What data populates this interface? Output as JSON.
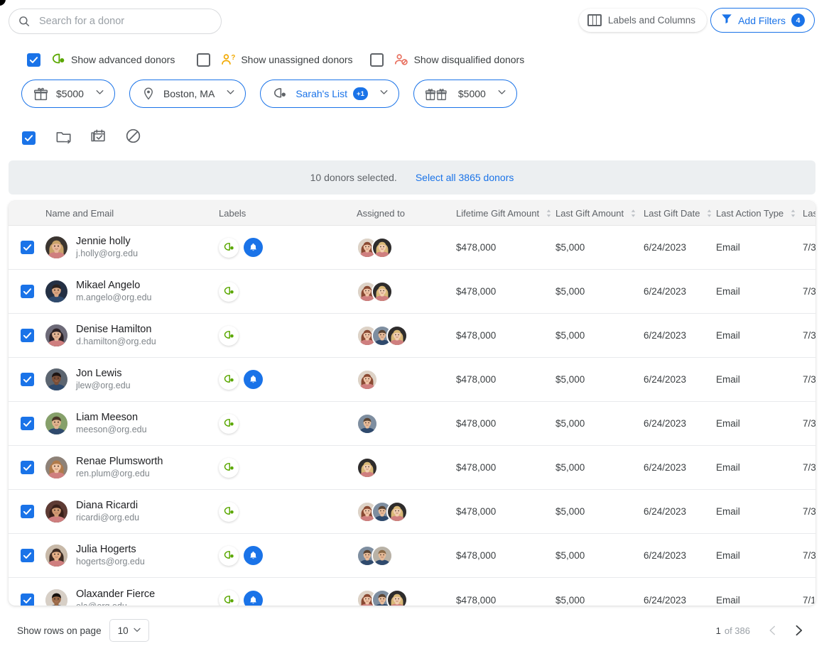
{
  "search": {
    "placeholder": "Search for a donor",
    "value": ""
  },
  "header": {
    "labels_columns": "Labels and Columns",
    "add_filters": "Add Filters",
    "add_filters_count": "4"
  },
  "toggles": [
    {
      "label": "Show advanced donors",
      "checked": true,
      "icon": "advanced-donor-icon"
    },
    {
      "label": "Show unassigned donors",
      "checked": false,
      "icon": "unassigned-donor-icon"
    },
    {
      "label": "Show disqualified donors",
      "checked": false,
      "icon": "disqualified-donor-icon"
    }
  ],
  "chips": [
    {
      "label": "$5000",
      "icon": "gift-icon",
      "blue": false,
      "badge": ""
    },
    {
      "label": "Boston, MA",
      "icon": "location-pin-icon",
      "blue": false,
      "badge": ""
    },
    {
      "label": "Sarah's List",
      "icon": "label-tag-icon",
      "blue": true,
      "badge": "+1"
    },
    {
      "label": "$5000",
      "icon": "double-gift-icon",
      "blue": false,
      "badge": ""
    }
  ],
  "bulk_actions": [
    {
      "name": "select-all-checkbox",
      "checked": true
    },
    {
      "name": "move-to-folder-icon"
    },
    {
      "name": "schedule-action-icon"
    },
    {
      "name": "disqualify-icon"
    }
  ],
  "selection_banner": {
    "count_text": "10 donors selected.",
    "select_all_link": "Select all 3865 donors"
  },
  "table": {
    "columns": [
      {
        "label": "Name and Email",
        "sortable": false
      },
      {
        "label": "Labels",
        "sortable": false
      },
      {
        "label": "Assigned to",
        "sortable": false
      },
      {
        "label": "Lifetime Gift Amount",
        "sortable": true
      },
      {
        "label": "Last Gift Amount",
        "sortable": true
      },
      {
        "label": "Last Gift Date",
        "sortable": true
      },
      {
        "label": "Last Action Type",
        "sortable": true
      },
      {
        "label": "Las",
        "sortable": false
      }
    ],
    "rows": [
      {
        "checked": true,
        "name": "Jennie holly",
        "email": "j.holly@org.edu",
        "avatar": "f1",
        "bell": true,
        "assigned": [
          "f2",
          "f3"
        ],
        "lifetime": "$478,000",
        "last_gift": "$5,000",
        "last_date": "6/24/2023",
        "last_action": "Email",
        "last_col": "7/3"
      },
      {
        "checked": true,
        "name": "Mikael Angelo",
        "email": "m.angelo@org.edu",
        "avatar": "m1",
        "bell": false,
        "assigned": [
          "f2",
          "f3"
        ],
        "lifetime": "$478,000",
        "last_gift": "$5,000",
        "last_date": "6/24/2023",
        "last_action": "Email",
        "last_col": "7/3"
      },
      {
        "checked": true,
        "name": "Denise Hamilton",
        "email": "d.hamilton@org.edu",
        "avatar": "f4",
        "bell": false,
        "assigned": [
          "f2",
          "m2",
          "f3"
        ],
        "lifetime": "$478,000",
        "last_gift": "$5,000",
        "last_date": "6/24/2023",
        "last_action": "Email",
        "last_col": "7/3"
      },
      {
        "checked": true,
        "name": "Jon Lewis",
        "email": "jlew@org.edu",
        "avatar": "m3",
        "bell": true,
        "assigned": [
          "f2"
        ],
        "lifetime": "$478,000",
        "last_gift": "$5,000",
        "last_date": "6/24/2023",
        "last_action": "Email",
        "last_col": "7/3"
      },
      {
        "checked": true,
        "name": "Liam Meeson",
        "email": "meeson@org.edu",
        "avatar": "m4",
        "bell": false,
        "assigned": [
          "m2"
        ],
        "lifetime": "$478,000",
        "last_gift": "$5,000",
        "last_date": "6/24/2023",
        "last_action": "Email",
        "last_col": "7/3"
      },
      {
        "checked": true,
        "name": "Renae Plumsworth",
        "email": "ren.plum@org.edu",
        "avatar": "f5",
        "bell": false,
        "assigned": [
          "f3"
        ],
        "lifetime": "$478,000",
        "last_gift": "$5,000",
        "last_date": "6/24/2023",
        "last_action": "Email",
        "last_col": "7/3"
      },
      {
        "checked": true,
        "name": "Diana Ricardi",
        "email": "ricardi@org.edu",
        "avatar": "f6",
        "bell": false,
        "assigned": [
          "f2",
          "m2",
          "f3"
        ],
        "lifetime": "$478,000",
        "last_gift": "$5,000",
        "last_date": "6/24/2023",
        "last_action": "Email",
        "last_col": "7/3"
      },
      {
        "checked": true,
        "name": "Julia Hogerts",
        "email": "hogerts@org.edu",
        "avatar": "f7",
        "bell": true,
        "assigned": [
          "m2",
          "m5"
        ],
        "lifetime": "$478,000",
        "last_gift": "$5,000",
        "last_date": "6/24/2023",
        "last_action": "Email",
        "last_col": "7/3"
      },
      {
        "checked": true,
        "name": "Olaxander Fierce",
        "email": "ola@org.edu",
        "avatar": "m6",
        "bell": true,
        "assigned": [
          "f2",
          "m2",
          "f3"
        ],
        "lifetime": "$478,000",
        "last_gift": "$5,000",
        "last_date": "6/24/2023",
        "last_action": "Email",
        "last_col": "7/1"
      }
    ]
  },
  "footer": {
    "rows_label": "Show rows on page",
    "rows_value": "10",
    "page_current": "1",
    "page_total": "of 386"
  },
  "colors": {
    "accent_blue": "#1a73e8",
    "label_green": "#5aa700",
    "warning_yellow": "#f2a900",
    "danger_red": "#e8705f",
    "banner_gray": "#eceff1"
  }
}
